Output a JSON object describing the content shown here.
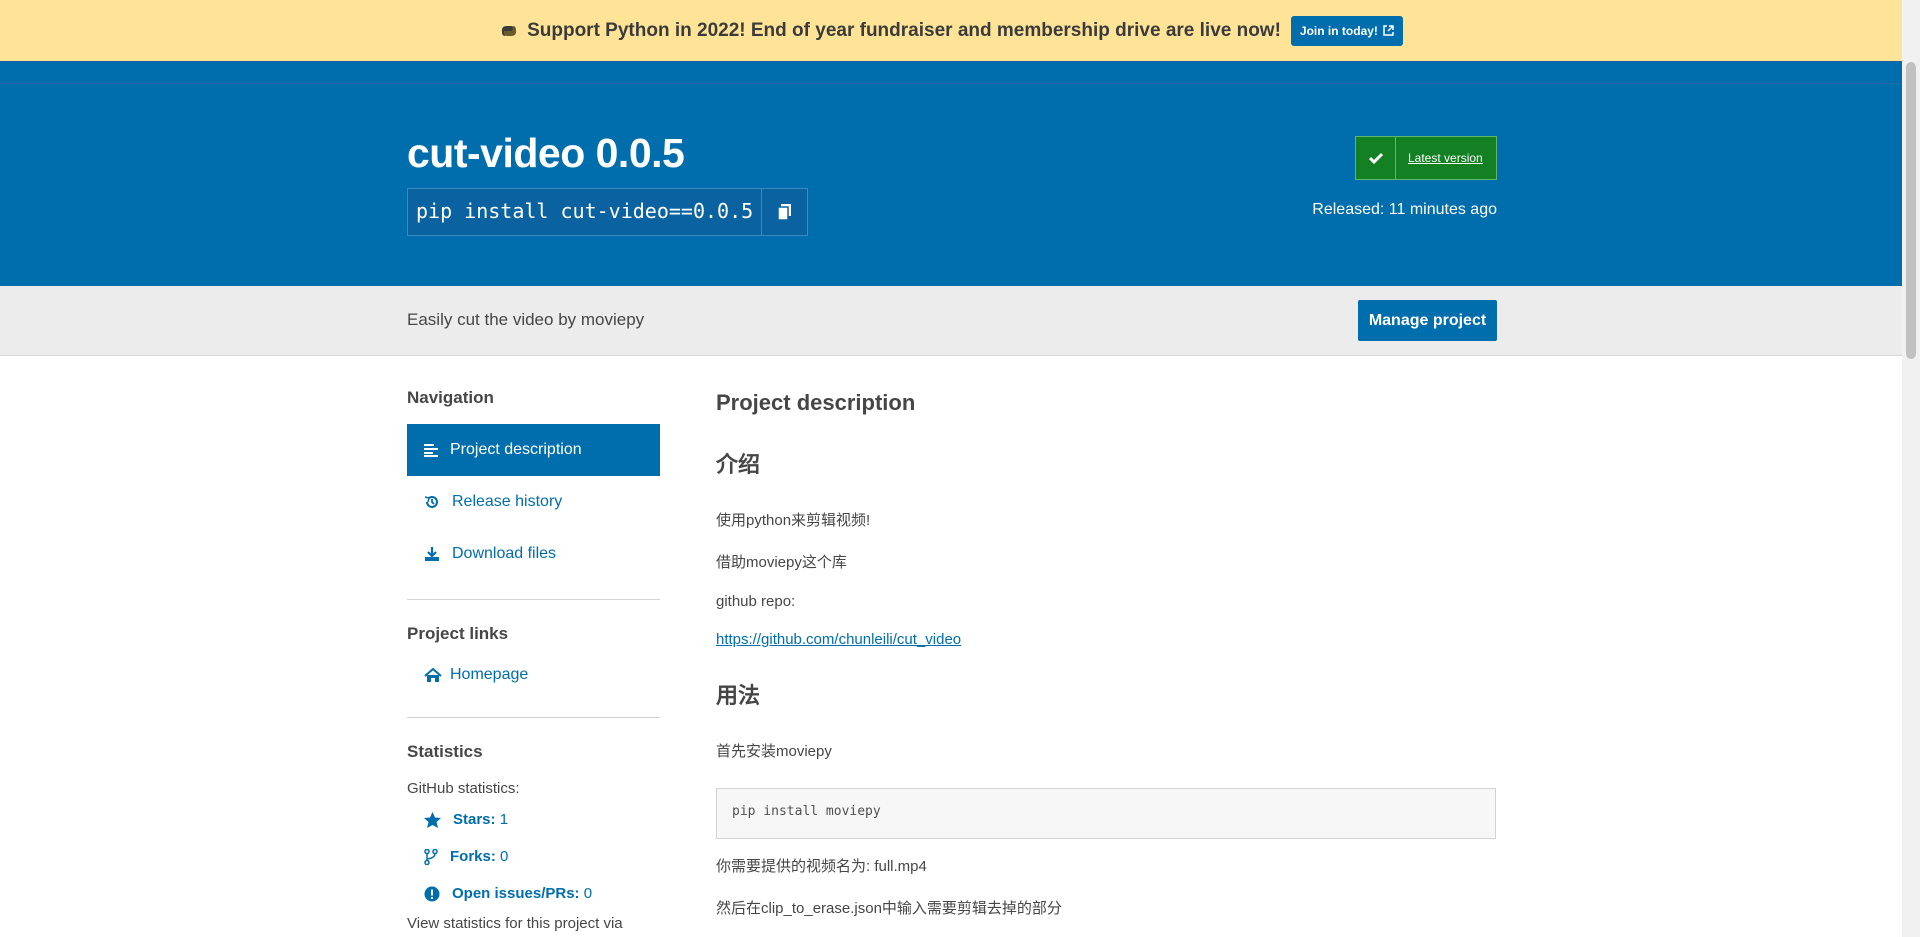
{
  "banner": {
    "text": "Support Python in 2022! End of year fundraiser and membership drive are live now!",
    "button_label": "Join in today!"
  },
  "header": {
    "title": "cut-video 0.0.5",
    "pip_command": "pip install cut-video==0.0.5",
    "latest_label": "Latest version",
    "released": "Released: 11 minutes ago"
  },
  "subbar": {
    "summary": "Easily cut the video by moviepy",
    "manage_label": "Manage project"
  },
  "sidebar": {
    "navigation_heading": "Navigation",
    "nav": [
      {
        "label": "Project description"
      },
      {
        "label": "Release history"
      },
      {
        "label": "Download files"
      }
    ],
    "links_heading": "Project links",
    "homepage_label": "Homepage",
    "statistics_heading": "Statistics",
    "github_label": "GitHub statistics:",
    "stats": [
      {
        "label": "Stars:",
        "value": "1"
      },
      {
        "label": "Forks:",
        "value": "0"
      },
      {
        "label": "Open issues/PRs:",
        "value": "0"
      }
    ],
    "more_stats": "View statistics for this project via"
  },
  "main": {
    "heading": "Project description",
    "intro_heading": "介绍",
    "intro_p1": "使用python来剪辑视频!",
    "intro_p2": "借助moviepy这个库",
    "intro_p3": "github repo:",
    "repo_link": "https://github.com/chunleili/cut_video",
    "usage_heading": "用法",
    "usage_p1": "首先安装moviepy",
    "code": "pip install moviepy",
    "usage_p2": "你需要提供的视频名为: full.mp4",
    "usage_p3": "然后在clip_to_erase.json中输入需要剪辑去掉的部分"
  },
  "colors": {
    "brand_blue": "#006dad",
    "banner_yellow": "#ffe497",
    "latest_green": "#148024"
  }
}
